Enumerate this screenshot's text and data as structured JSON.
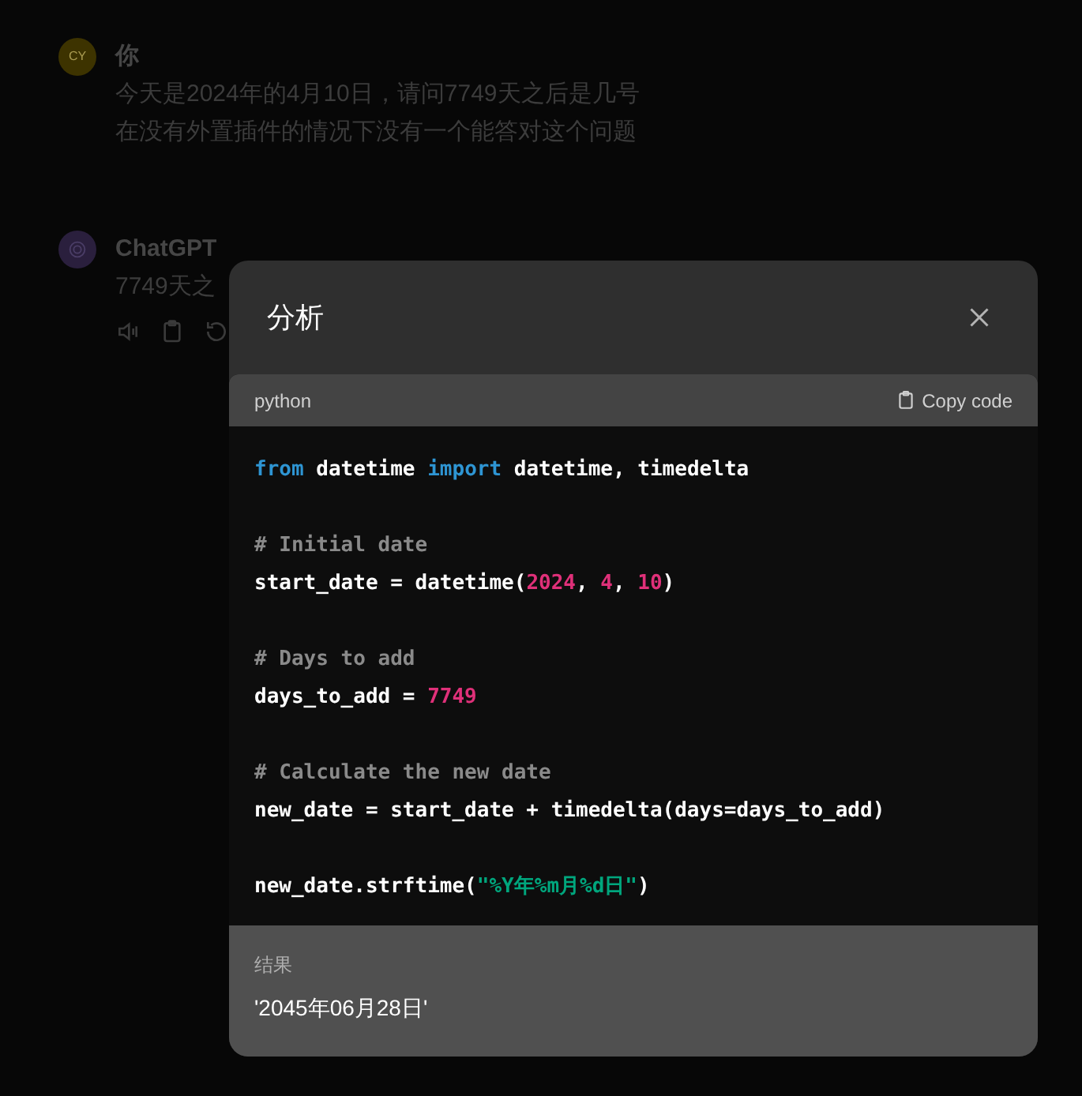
{
  "conversation": [
    {
      "author": "你",
      "avatar": "CY",
      "kind": "user",
      "lines": [
        "今天是2024年的4月10日，请问7749天之后是几号",
        "在没有外置插件的情况下没有一个能答对这个问题"
      ]
    },
    {
      "author": "ChatGPT",
      "kind": "assistant",
      "lines": [
        "7749天之"
      ]
    }
  ],
  "dialog": {
    "title": "分析",
    "code": {
      "language": "python",
      "copy_label": "Copy code",
      "blocks": [
        [
          [
            {
              "kind": "keyword",
              "text": "from"
            },
            {
              "kind": "plain",
              "text": " datetime "
            },
            {
              "kind": "keyword",
              "text": "import"
            },
            {
              "kind": "plain",
              "text": " datetime, timedelta"
            }
          ]
        ],
        [
          [
            {
              "kind": "comment",
              "text": "# Initial date"
            }
          ],
          [
            {
              "kind": "plain",
              "text": "start_date = datetime("
            },
            {
              "kind": "number",
              "text": "2024"
            },
            {
              "kind": "plain",
              "text": ", "
            },
            {
              "kind": "number",
              "text": "4"
            },
            {
              "kind": "plain",
              "text": ", "
            },
            {
              "kind": "number",
              "text": "10"
            },
            {
              "kind": "plain",
              "text": ")"
            }
          ]
        ],
        [
          [
            {
              "kind": "comment",
              "text": "# Days to add"
            }
          ],
          [
            {
              "kind": "plain",
              "text": "days_to_add = "
            },
            {
              "kind": "number",
              "text": "7749"
            }
          ]
        ],
        [
          [
            {
              "kind": "comment",
              "text": "# Calculate the new date"
            }
          ],
          [
            {
              "kind": "plain",
              "text": "new_date = start_date + timedelta(days=days_to_add)"
            }
          ]
        ],
        [
          [
            {
              "kind": "plain",
              "text": "new_date.strftime("
            },
            {
              "kind": "string",
              "text": "\"%Y年%m月%d日\""
            },
            {
              "kind": "plain",
              "text": ")"
            }
          ]
        ]
      ]
    },
    "result": {
      "label": "结果",
      "value": "'2045年06月28日'"
    }
  }
}
